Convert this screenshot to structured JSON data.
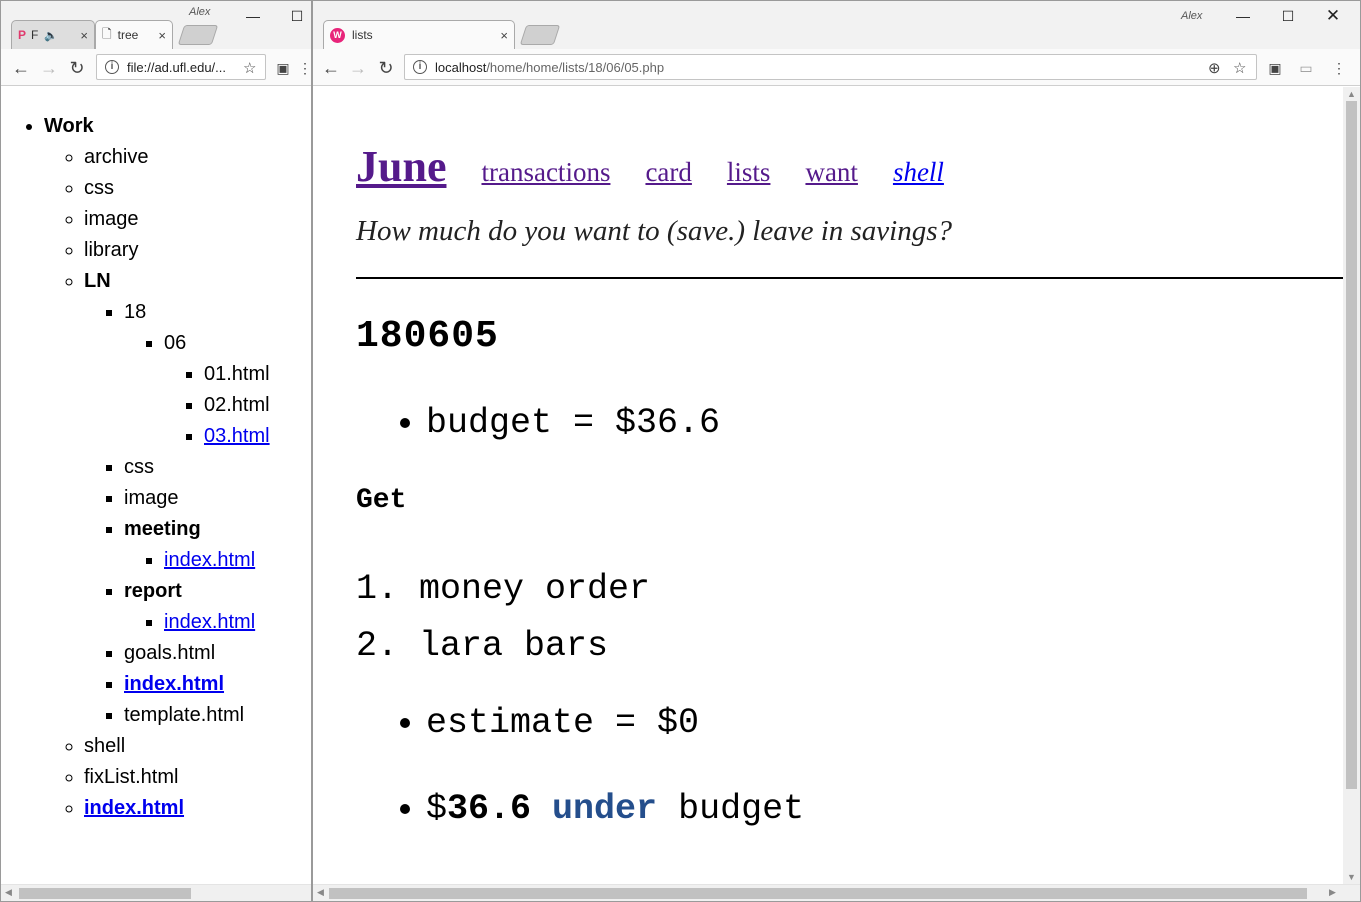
{
  "left_window": {
    "user_label": "Alex",
    "tabs": [
      {
        "label": "F",
        "audio": "🔈"
      },
      {
        "label": "tree"
      }
    ],
    "address": "file://ad.ufl.edu/...",
    "tree": {
      "root": "Work",
      "children": [
        "archive",
        "css",
        "image",
        "library"
      ],
      "ln": {
        "label": "LN",
        "year": "18",
        "month": "06",
        "files": [
          "01.html",
          "02.html",
          "03.html"
        ],
        "css": "css",
        "image": "image",
        "meeting": "meeting",
        "meeting_index": "index.html",
        "report": "report",
        "report_index": "index.html",
        "goals": "goals.html",
        "index": "index.html",
        "template": "template.html"
      },
      "after": [
        "shell",
        "fixList.html"
      ],
      "index": "index.html"
    }
  },
  "right_window": {
    "user_label": "Alex",
    "tab_label": "lists",
    "address_host": "localhost",
    "address_path": "/home/home/lists/18/06/05.php",
    "page": {
      "title": "June",
      "nav": [
        "transactions",
        "card",
        "lists",
        "want",
        "shell"
      ],
      "tagline": "How much do you want to (save.) leave in savings?",
      "date": "180605",
      "budget": "budget = $36.6",
      "get_heading": "Get",
      "get_items": [
        "1. money order",
        "2. lara bars"
      ],
      "estimate": "estimate = $0",
      "under_dollar": "$",
      "under_amount": "36.6",
      "under_word": "under",
      "under_tail": "budget"
    }
  },
  "colors": {
    "visited_link": "#551a8b",
    "link": "#0000ee",
    "under": "#244e8c"
  }
}
